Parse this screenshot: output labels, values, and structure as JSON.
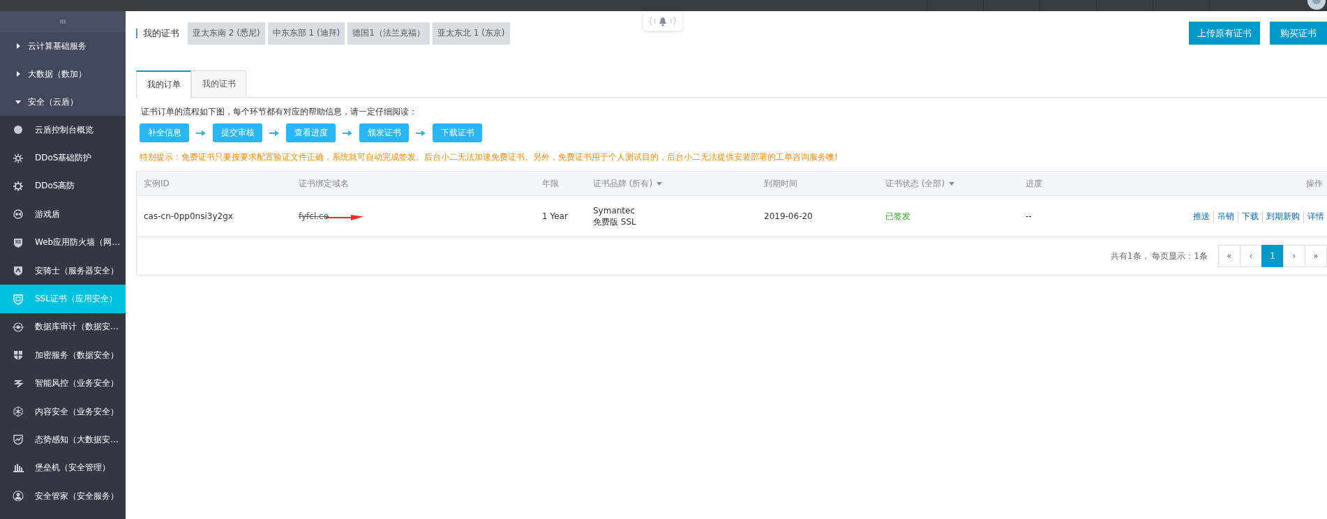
{
  "sidebar": {
    "items": [
      {
        "kind": "group",
        "label": "云计算基础服务",
        "expanded": false
      },
      {
        "kind": "group",
        "label": "大数据（数加）",
        "expanded": false
      },
      {
        "kind": "group",
        "label": "安全（云盾）",
        "expanded": true,
        "children": [
          {
            "label": "云盾控制台概览",
            "selected": false
          },
          {
            "label": "DDoS基础防护",
            "selected": false
          },
          {
            "label": "DDoS高防",
            "selected": false
          },
          {
            "label": "游戏盾",
            "selected": false
          },
          {
            "label": "Web应用防火墙（网…",
            "selected": false
          },
          {
            "label": "安骑士（服务器安全）",
            "selected": false
          },
          {
            "label": "SSL证书（应用安全）",
            "selected": true
          },
          {
            "label": "数据库审计（数据安…",
            "selected": false
          },
          {
            "label": "加密服务（数据安全）",
            "selected": false
          },
          {
            "label": "智能风控（业务安全）",
            "selected": false
          },
          {
            "label": "内容安全（业务安全）",
            "selected": false
          },
          {
            "label": "态势感知（大数据安…",
            "selected": false
          },
          {
            "label": "堡垒机（安全管理）",
            "selected": false
          },
          {
            "label": "安全管家（安全服务）",
            "selected": false
          }
        ]
      }
    ]
  },
  "header": {
    "title": "我的证书",
    "regions": [
      "亚太东南 2 (悉尼)",
      "中东东部 1 (迪拜)",
      "德国1（法兰克福）",
      "亚太东北 1 (东京)"
    ],
    "buttons": [
      "上传原有证书",
      "购买证书"
    ]
  },
  "tabs": [
    {
      "label": "我的订单",
      "selected": true
    },
    {
      "label": "我的证书",
      "selected": false
    }
  ],
  "intro": "证书订单的流程如下图，每个环节都有对应的帮助信息，请一定仔细阅读：",
  "steps": [
    "补全信息",
    "提交审核",
    "查看进度",
    "颁发证书",
    "下载证书"
  ],
  "notice": "特别提示：免费证书只要按要求配置验证文件正确，系统就可自动完成签发。后台小二无法加速免费证书。另外，免费证书用于个人测试目的，后台小二无法提供安装部署的工单咨询服务噢!",
  "table": {
    "columns": [
      {
        "label": "实例ID",
        "dropdown": false
      },
      {
        "label": "证书绑定域名",
        "dropdown": false
      },
      {
        "label": "年限",
        "dropdown": false
      },
      {
        "label": "证书品牌 (所有)",
        "dropdown": true
      },
      {
        "label": "到期时间",
        "dropdown": false
      },
      {
        "label": "证书状态 (全部)",
        "dropdown": true
      },
      {
        "label": "进度",
        "dropdown": false
      },
      {
        "label": "操作",
        "dropdown": false
      }
    ],
    "rows": [
      {
        "id": "cas-cn-0pp0nsi3y2gx",
        "domain": "fyfcl.co",
        "term": "1 Year",
        "brand": [
          "Symantec",
          "免费版 SSL"
        ],
        "expiry": "2019-06-20",
        "status": "已签发",
        "progress": "--",
        "actions": [
          "推送",
          "吊销",
          "下载",
          "到期新购",
          "详情"
        ]
      }
    ]
  },
  "pagination": {
    "summary": "共有1条， 每页显示：1条",
    "pages": [
      {
        "label": "«",
        "selected": false
      },
      {
        "label": "‹",
        "selected": false
      },
      {
        "label": "1",
        "selected": true
      },
      {
        "label": "›",
        "selected": false
      },
      {
        "label": "»",
        "selected": false
      }
    ]
  }
}
